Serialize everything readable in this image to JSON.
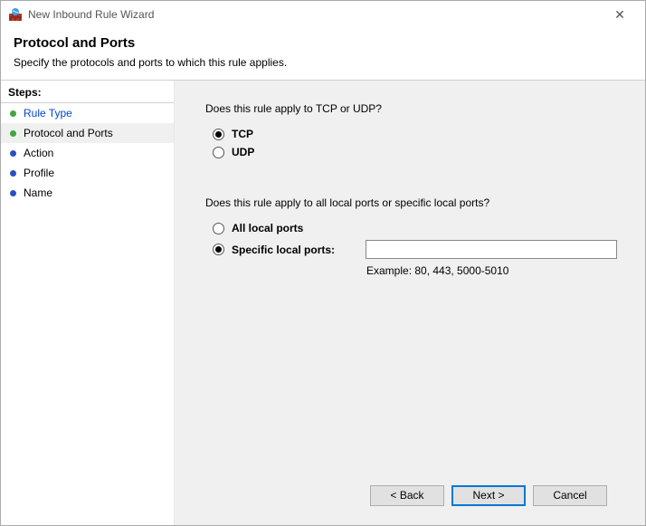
{
  "window": {
    "title": "New Inbound Rule Wizard"
  },
  "header": {
    "title": "Protocol and Ports",
    "subtitle": "Specify the protocols and ports to which this rule applies."
  },
  "sidebar": {
    "header": "Steps:",
    "items": [
      {
        "label": "Rule Type",
        "state": "done",
        "linkStyle": true,
        "current": false
      },
      {
        "label": "Protocol and Ports",
        "state": "done",
        "linkStyle": false,
        "current": true
      },
      {
        "label": "Action",
        "state": "pending",
        "linkStyle": false,
        "current": false
      },
      {
        "label": "Profile",
        "state": "pending",
        "linkStyle": false,
        "current": false
      },
      {
        "label": "Name",
        "state": "pending",
        "linkStyle": false,
        "current": false
      }
    ]
  },
  "content": {
    "protocolQuestion": "Does this rule apply to TCP or UDP?",
    "protocolOptions": {
      "tcp": "TCP",
      "udp": "UDP",
      "selected": "tcp"
    },
    "portsQuestion": "Does this rule apply to all local ports or specific local ports?",
    "portsOptions": {
      "all": "All local ports",
      "specific": "Specific local ports:",
      "selected": "specific"
    },
    "portsInput": "",
    "portsExample": "Example: 80, 443, 5000-5010"
  },
  "footer": {
    "back": "< Back",
    "next": "Next >",
    "cancel": "Cancel"
  }
}
